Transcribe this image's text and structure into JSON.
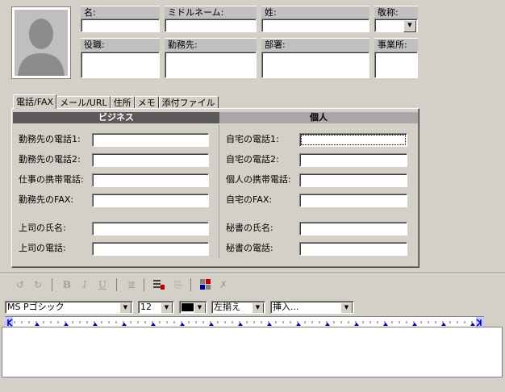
{
  "header": {
    "labels": {
      "first_name": "名:",
      "middle_name": "ミドルネーム:",
      "last_name": "姓:",
      "title": "敬称:",
      "job_title": "役職:",
      "company": "勤務先:",
      "department": "部署:",
      "office": "事業所:"
    }
  },
  "tabs": [
    "電話/FAX",
    "メール/URL",
    "住所",
    "メモ",
    "添付ファイル"
  ],
  "business": {
    "heading": "ビジネス",
    "fields": [
      "勤務先の電話1:",
      "勤務先の電話2:",
      "仕事の携帯電話:",
      "勤務先のFAX:"
    ],
    "fields2": [
      "上司の氏名:",
      "上司の電話:"
    ]
  },
  "personal": {
    "heading": "個人",
    "fields": [
      "自宅の電話1:",
      "自宅の電話2:",
      "個人の携帯電話:",
      "自宅のFAX:"
    ],
    "fields2": [
      "秘書の氏名:",
      "秘書の電話:"
    ]
  },
  "toolbar": {
    "icons": [
      "undo-icon",
      "redo-icon",
      "bold-icon",
      "italic-icon",
      "underline-icon",
      "bullet-list-icon",
      "insert-table-icon",
      "attach-icon",
      "image-icon",
      "spell-check-icon"
    ],
    "bold_glyph": "B",
    "italic_glyph": "I",
    "underline_glyph": "U"
  },
  "format": {
    "font": "MS Pゴシック",
    "size": "12",
    "align": "左揃え",
    "insert": "挿入..."
  },
  "colors": {
    "window_bg": "#d4d0c8",
    "business_header_bg": "#5a5a5a",
    "business_header_fg": "#ffffff",
    "personal_header_bg": "#a8a8a8"
  }
}
